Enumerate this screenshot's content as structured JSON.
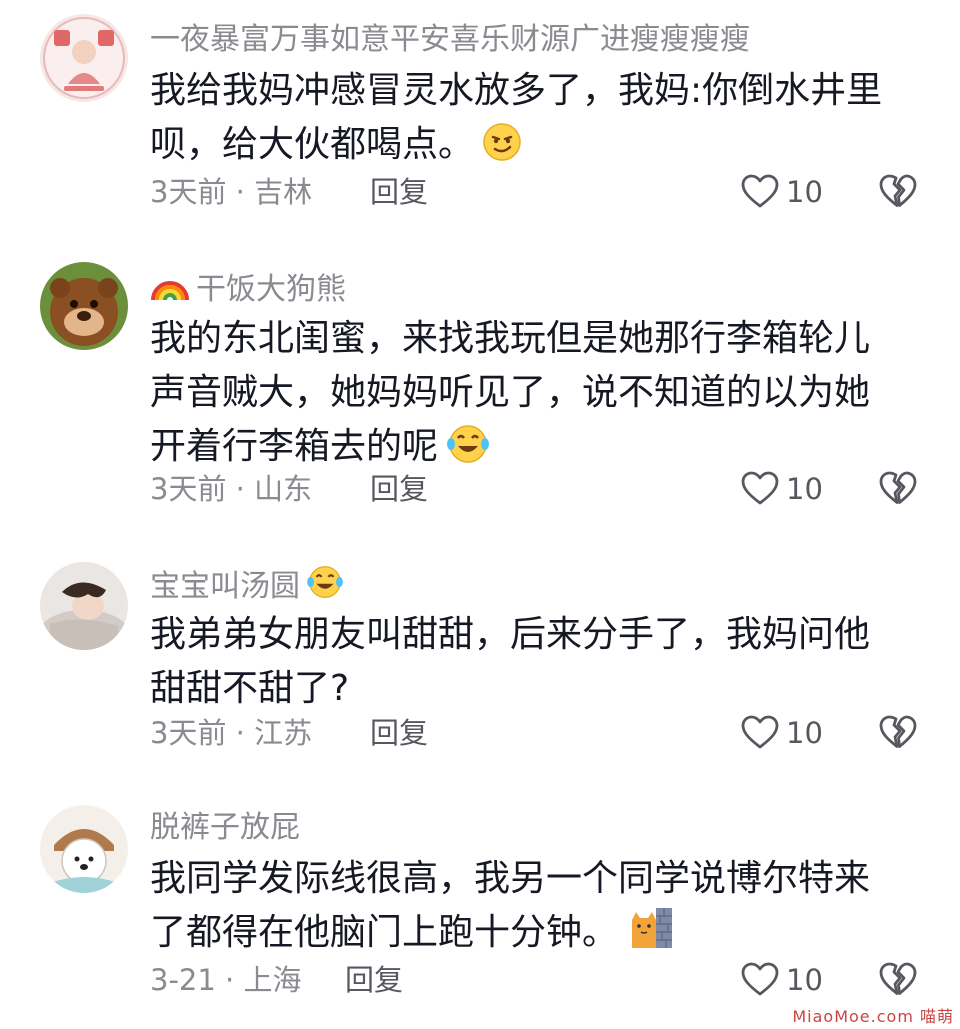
{
  "comments": [
    {
      "username": "一夜暴富万事如意平安喜乐财源广进瘦瘦瘦瘦",
      "lines": [
        "我给我妈冲感冒灵水放多了，我妈:你倒水井里",
        "呗，给大伙都喝点。"
      ],
      "time": "3天前",
      "location": "吉林",
      "reply_label": "回复",
      "like_count": "10",
      "emoji": "smirk-emoji"
    },
    {
      "username": "干饭大狗熊",
      "lines": [
        "我的东北闺蜜，来找我玩但是她那行李箱轮儿",
        "声音贼大，她妈妈听见了，说不知道的以为她",
        "开着行李箱去的呢"
      ],
      "time": "3天前",
      "location": "山东",
      "reply_label": "回复",
      "like_count": "10",
      "emoji": "crying-laughing-emoji"
    },
    {
      "username": "宝宝叫汤圆",
      "lines": [
        "我弟弟女朋友叫甜甜，后来分手了，我妈问他",
        "甜甜不甜了?"
      ],
      "time": "3天前",
      "location": "江苏",
      "reply_label": "回复",
      "like_count": "10"
    },
    {
      "username": "脱裤子放屁",
      "lines": [
        "我同学发际线很高，我另一个同学说博尔特来",
        "了都得在他脑门上跑十分钟。"
      ],
      "time": "3-21",
      "location": "上海",
      "reply_label": "回复",
      "like_count": "10",
      "emoji": "cat-wall-emoji"
    }
  ],
  "separator": " · ",
  "watermark": "MiaoMoe.com 喵萌",
  "colors": {
    "text": "#161823",
    "secondary": "#8a8b91",
    "action": "#57585f"
  },
  "icons": [
    "heart-outline-icon",
    "broken-heart-icon",
    "rainbow-icon"
  ]
}
